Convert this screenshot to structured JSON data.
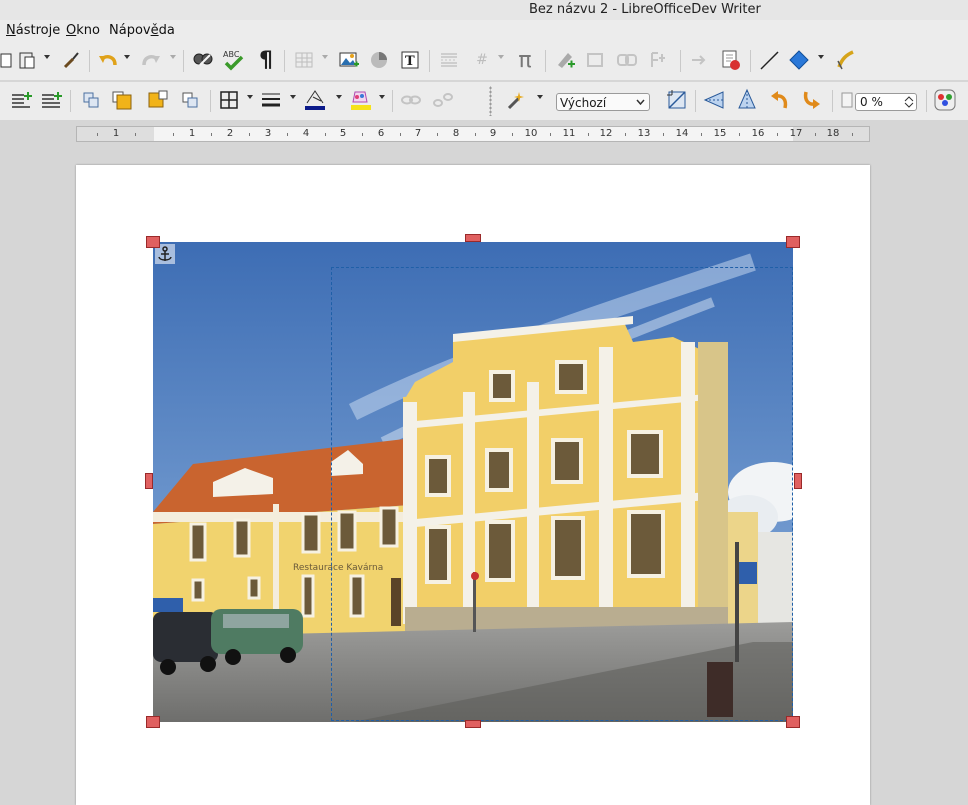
{
  "window": {
    "title": "Bez názvu 2 - LibreOfficeDev Writer"
  },
  "menu": {
    "items": [
      {
        "pre": "",
        "ul": "N",
        "post": "ástroje"
      },
      {
        "pre": "",
        "ul": "O",
        "post": "kno"
      },
      {
        "pre": "Nápov",
        "ul": "ě",
        "post": "da"
      }
    ]
  },
  "toolbar_top": {
    "icons": [
      "copy-icon",
      "paste-icon",
      "clone-formatting-icon",
      "undo-icon",
      "redo-icon",
      "find-replace-icon",
      "spellcheck-icon",
      "formatting-marks-icon",
      "insert-table-icon",
      "insert-image-icon",
      "insert-chart-icon",
      "insert-textbox-icon",
      "insert-page-break-icon",
      "insert-field-icon",
      "insert-special-character-icon",
      "insert-comment-icon",
      "track-changes-icon",
      "insert-hyperlink-icon",
      "insert-footnote-icon",
      "insert-cross-reference-icon",
      "insert-line-icon",
      "basic-shapes-icon",
      "draw-function-icon"
    ],
    "special_char_glyph": "π",
    "field_glyph": "#",
    "spellcheck_label": "ABC"
  },
  "toolbar_frame": {
    "icons": [
      "wrap-off-icon",
      "wrap-on-icon",
      "bring-to-front-icon",
      "send-to-back-icon",
      "forward-one-icon",
      "back-one-icon",
      "borders-icon",
      "border-style-icon",
      "border-color-icon",
      "background-color-icon",
      "link-frames-icon",
      "unlink-frames-icon",
      "image-filter-icon",
      "crop-icon",
      "flip-vertical-icon",
      "flip-horizontal-icon",
      "rotate-left-icon",
      "rotate-right-icon",
      "transparency-icon",
      "color-icon"
    ],
    "graphics_mode": "Výchozí",
    "transparency_value": "0 %"
  },
  "ruler": {
    "labels": [
      "1",
      "1",
      "2",
      "3",
      "4",
      "5",
      "6",
      "7",
      "8",
      "9",
      "10",
      "11",
      "12",
      "13",
      "14",
      "15",
      "16",
      "17",
      "18"
    ]
  },
  "colors": {
    "selection_handle": "#e06060",
    "crop_frame": "#1f5fa8",
    "chrome": "#ececec",
    "canvas": "#d6d6d6"
  }
}
